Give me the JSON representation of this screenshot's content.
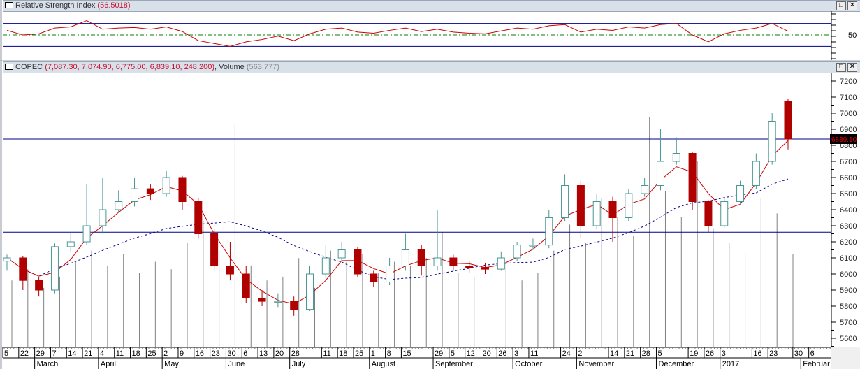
{
  "rsi_panel": {
    "title": "Relative Strength Index",
    "value": "(56.5018)",
    "axis_label": "50"
  },
  "price_panel": {
    "symbol": "COPEC",
    "ohlc": "(7,087.30, 7,074.90, 6,775.00, 6,839.10,   248.200)",
    "volume_label": ", Volume",
    "volume_value": "(563,777)",
    "last_price_tag": "6839.10",
    "axis_ticks": [
      "7200",
      "7100",
      "7000",
      "6900",
      "6800",
      "6700",
      "6600",
      "6500",
      "6400",
      "6300",
      "6200",
      "6100",
      "6000",
      "5900",
      "5800",
      "5700",
      "5600"
    ]
  },
  "window_buttons": {
    "maximize": "□",
    "close": "✕"
  },
  "colors": {
    "up": "#4a9696",
    "down": "#b00000",
    "ma_short": "#cc0000",
    "ma_long": "#00008b",
    "hline": "#00008b",
    "rsi": "#cc0000",
    "rsi_mid": "#008000",
    "volume": "#808080"
  },
  "chart_data": {
    "type": "candlestick",
    "title": "COPEC",
    "x": [
      "2016-02-15",
      "2016-02-22",
      "2016-02-29",
      "2016-03-07",
      "2016-03-14",
      "2016-03-21",
      "2016-04-04",
      "2016-04-11",
      "2016-04-18",
      "2016-04-25",
      "2016-05-02",
      "2016-05-09",
      "2016-05-16",
      "2016-05-23",
      "2016-05-30",
      "2016-06-06",
      "2016-06-13",
      "2016-06-20",
      "2016-06-28",
      "2016-07-04",
      "2016-07-11",
      "2016-07-18",
      "2016-07-25",
      "2016-08-01",
      "2016-08-08",
      "2016-08-15",
      "2016-08-22",
      "2016-08-29",
      "2016-09-05",
      "2016-09-12",
      "2016-09-20",
      "2016-09-26",
      "2016-10-03",
      "2016-10-11",
      "2016-10-17",
      "2016-10-24",
      "2016-11-02",
      "2016-11-07",
      "2016-11-14",
      "2016-11-21",
      "2016-11-28",
      "2016-12-05",
      "2016-12-12",
      "2016-12-19",
      "2016-12-26",
      "2017-01-03",
      "2017-01-09",
      "2017-01-16",
      "2017-01-23",
      "2017-01-27"
    ],
    "tick_labels": [
      "5",
      "22",
      "29",
      "7",
      "14",
      "21",
      "4",
      "11",
      "18",
      "25",
      "2",
      "9",
      "16",
      "23",
      "30",
      "6",
      "13",
      "20",
      "28",
      "",
      "11",
      "18",
      "25",
      "1",
      "8",
      "15",
      "",
      "29",
      "5",
      "12",
      "20",
      "26",
      "3",
      "11",
      "",
      "24",
      "2",
      "",
      "14",
      "21",
      "28",
      "5",
      "",
      "19",
      "26",
      "3",
      "",
      "16",
      "23",
      ""
    ],
    "extra_tick_labels": [
      "30",
      "6"
    ],
    "months": [
      {
        "label": "March",
        "start": "2016-02-29"
      },
      {
        "label": "April",
        "start": "2016-04-04"
      },
      {
        "label": "May",
        "start": "2016-05-02"
      },
      {
        "label": "June",
        "start": "2016-05-30"
      },
      {
        "label": "July",
        "start": "2016-06-28"
      },
      {
        "label": "August",
        "start": "2016-08-01"
      },
      {
        "label": "September",
        "start": "2016-08-29"
      },
      {
        "label": "October",
        "start": "2016-10-03"
      },
      {
        "label": "November",
        "start": "2016-11-02"
      },
      {
        "label": "December",
        "start": "2016-12-05"
      },
      {
        "label": "2017",
        "start": "2017-01-03"
      },
      {
        "label": "Februar",
        "start": "next"
      }
    ],
    "close": [
      6100,
      5960,
      5900,
      6170,
      6200,
      6300,
      6400,
      6450,
      6530,
      6500,
      6600,
      6450,
      6250,
      6050,
      6000,
      5850,
      5830,
      5830,
      5780,
      6000,
      6100,
      6150,
      6000,
      5950,
      6050,
      6150,
      6050,
      6100,
      6050,
      6040,
      6030,
      6100,
      6180,
      6180,
      6350,
      6550,
      6300,
      6450,
      6350,
      6500,
      6550,
      6700,
      6750,
      6450,
      6300,
      6450,
      6550,
      6700,
      6950,
      6839.1
    ],
    "open": [
      6080,
      6100,
      5960,
      5900,
      6170,
      6200,
      6300,
      6400,
      6450,
      6530,
      6500,
      6600,
      6450,
      6250,
      6050,
      6000,
      5850,
      5830,
      5830,
      5780,
      6000,
      6100,
      6150,
      6000,
      5950,
      6050,
      6150,
      6050,
      6100,
      6050,
      6040,
      6030,
      6100,
      6180,
      6180,
      6350,
      6550,
      6300,
      6450,
      6350,
      6500,
      6550,
      6700,
      6750,
      6450,
      6300,
      6450,
      6550,
      6700,
      7074.9
    ],
    "high": [
      6120,
      6110,
      5980,
      6190,
      6260,
      6560,
      6600,
      6520,
      6600,
      6560,
      6640,
      6610,
      6470,
      6280,
      6200,
      6050,
      5900,
      5880,
      5860,
      6050,
      6180,
      6200,
      6170,
      6020,
      6100,
      6250,
      6180,
      6400,
      6120,
      6080,
      6070,
      6140,
      6200,
      6220,
      6400,
      6620,
      6580,
      6500,
      6480,
      6530,
      6600,
      6900,
      6850,
      6760,
      6460,
      6480,
      6580,
      6750,
      7000,
      7087.3
    ],
    "low": [
      6020,
      5900,
      5860,
      5880,
      6140,
      6180,
      6250,
      6380,
      6420,
      6460,
      6480,
      6400,
      6220,
      6020,
      5960,
      5820,
      5800,
      5790,
      5740,
      5770,
      5980,
      6080,
      5980,
      5920,
      5930,
      6020,
      5990,
      6020,
      6020,
      6010,
      6000,
      6020,
      6080,
      6150,
      6160,
      6330,
      6220,
      6280,
      6200,
      6330,
      6480,
      6520,
      6680,
      6400,
      6260,
      6290,
      6430,
      6530,
      6680,
      6775
    ],
    "volume": [
      180,
      210,
      160,
      190,
      230,
      260,
      220,
      250,
      200,
      230,
      210,
      280,
      340,
      260,
      600,
      220,
      180,
      190,
      240,
      160,
      260,
      230,
      250,
      200,
      230,
      220,
      240,
      310,
      200,
      190,
      210,
      230,
      180,
      200,
      260,
      330,
      280,
      400,
      350,
      300,
      620,
      420,
      350,
      500,
      320,
      280,
      250,
      400,
      360,
      250
    ],
    "moving_averages": [
      "short (red line)",
      "long (blue dashed)"
    ],
    "horizontal_lines": [
      6839.1,
      6260
    ],
    "ylim": [
      5550,
      7260
    ],
    "rsi": {
      "values": [
        58,
        50,
        52,
        62,
        64,
        75,
        60,
        62,
        63,
        60,
        64,
        56,
        40,
        35,
        30,
        38,
        42,
        48,
        40,
        52,
        60,
        62,
        55,
        53,
        58,
        62,
        56,
        60,
        55,
        53,
        52,
        57,
        62,
        60,
        66,
        68,
        55,
        60,
        58,
        64,
        62,
        68,
        70,
        50,
        38,
        52,
        58,
        62,
        70,
        56.5
      ],
      "levels": [
        70,
        50,
        30
      ]
    }
  }
}
